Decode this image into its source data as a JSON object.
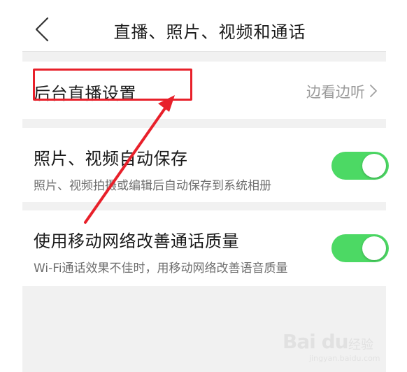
{
  "header": {
    "title": "直播、照片、视频和通话",
    "back_icon": "chevron-left-icon"
  },
  "rows": {
    "live": {
      "title": "后台直播设置",
      "value": "边看边听",
      "chevron_icon": "chevron-right-icon"
    },
    "media": {
      "title": "照片、视频自动保存",
      "subtitle": "照片、视频拍摄或编辑后自动保存到系统相册",
      "toggle_on": true
    },
    "network": {
      "title": "使用移动网络改善通话质量",
      "subtitle": "Wi-Fi通话效果不佳时，用移动网络改善语音质量",
      "toggle_on": true
    }
  },
  "annotation": {
    "box_color": "#e8202a",
    "arrow_color": "#e8202a"
  },
  "watermark": {
    "logo": "Bai du",
    "text": "经验",
    "url": "jingyan.baidu.com"
  },
  "colors": {
    "toggle_on": "#4cd964",
    "background": "#f1f1f1",
    "title_text": "#1a1a1a",
    "sub_text": "#6e6e6e",
    "value_text": "#9a9a9a"
  }
}
